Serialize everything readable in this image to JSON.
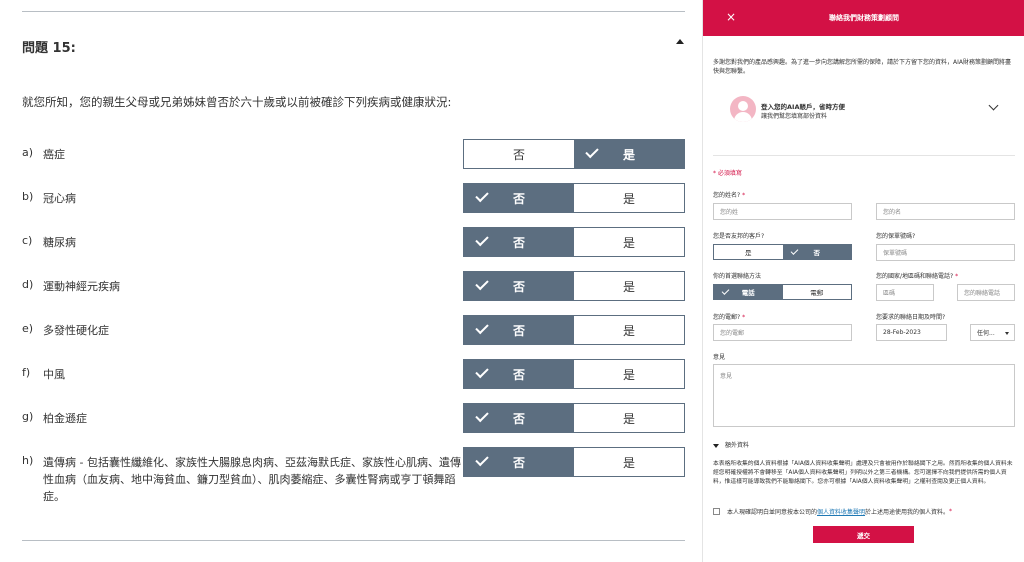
{
  "questionnaire": {
    "title": "問題 15:",
    "question": "就您所知，您的親生父母或兄弟姊妹曾否於六十歲或以前被確診下列疾病或健康狀況:",
    "options": {
      "no": "否",
      "yes": "是"
    },
    "items": [
      {
        "letter": "a)",
        "label": "癌症",
        "selected": "yes"
      },
      {
        "letter": "b)",
        "label": "冠心病",
        "selected": "no"
      },
      {
        "letter": "c)",
        "label": "糖尿病",
        "selected": "no"
      },
      {
        "letter": "d)",
        "label": "運動神經元疾病",
        "selected": "no"
      },
      {
        "letter": "e)",
        "label": "多發性硬化症",
        "selected": "no"
      },
      {
        "letter": "f)",
        "label": "中風",
        "selected": "no"
      },
      {
        "letter": "g)",
        "label": "柏金遜症",
        "selected": "no"
      },
      {
        "letter": "h)",
        "label": "遺傳病 - 包括囊性纖維化、家族性大腸腺息肉病、亞茲海默氏症、家族性心肌病、遺傳性血病（血友病、地中海貧血、鐮刀型貧血）、肌肉萎縮症、多囊性腎病或亨丁頓舞蹈症。",
        "selected": "no"
      }
    ]
  },
  "panel": {
    "title": "聯絡我們財務策劃顧問",
    "close_icon": "×",
    "intro": "多謝您對我們的產品感興趣。為了進一步向您講解您所需的保障，請於下方留下您的資料，AIA財務策劃顧問將盡快與您聯繫。",
    "login_title": "登入您的AIA賬戶，省時方便",
    "login_subtitle": "讓我們幫您填寫部份資料",
    "required_note": "* 必須填寫",
    "last_name_label": "您的姓名?",
    "last_name_placeholder": "您的姓",
    "first_name_placeholder": "您的名",
    "existing_customer_label": "您是否友邦的客戶?",
    "existing_yes": "是",
    "existing_no": "否",
    "policy_label": "您的保單號碼?",
    "policy_placeholder": "保單號碼",
    "contact_method_label": "你的首選聯絡方法",
    "contact_phone": "電話",
    "contact_email": "電郵",
    "country_label": "您的國家/地區碼和聯絡電話?",
    "area_code_placeholder": "區碼",
    "phone_placeholder": "您的聯絡電話",
    "email_label": "您的電郵?",
    "email_placeholder": "您的電郵",
    "date_label": "您要求的聯絡日期及時間?",
    "date_value": "28-Feb-2023",
    "time_value": "任何...",
    "comments_label": "意見",
    "comments_placeholder": "意見",
    "extra_label": "額外資料",
    "notice": "本表格所收集的個人資料根據「AIA個人資料收集聲明」處理及只會被用作於聯絡閣下之用。然而所收集的個人資料未經您明確授權將不會轉移至「AIA個人資料收集聲明」列明以外之第三者機構。您可選擇不向我們提供所需的個人資料，惟這樣可能導致我們不能聯絡閣下。您亦可根據「AIA個人資料收集聲明」之權利查閱及更正個人資料。",
    "consent_prefix": "本人現確認明白並同意按本公司的",
    "consent_link": "個人資料收集聲明",
    "consent_suffix": "於上述用途使用我的個人資料。",
    "submit_label": "遞交"
  }
}
